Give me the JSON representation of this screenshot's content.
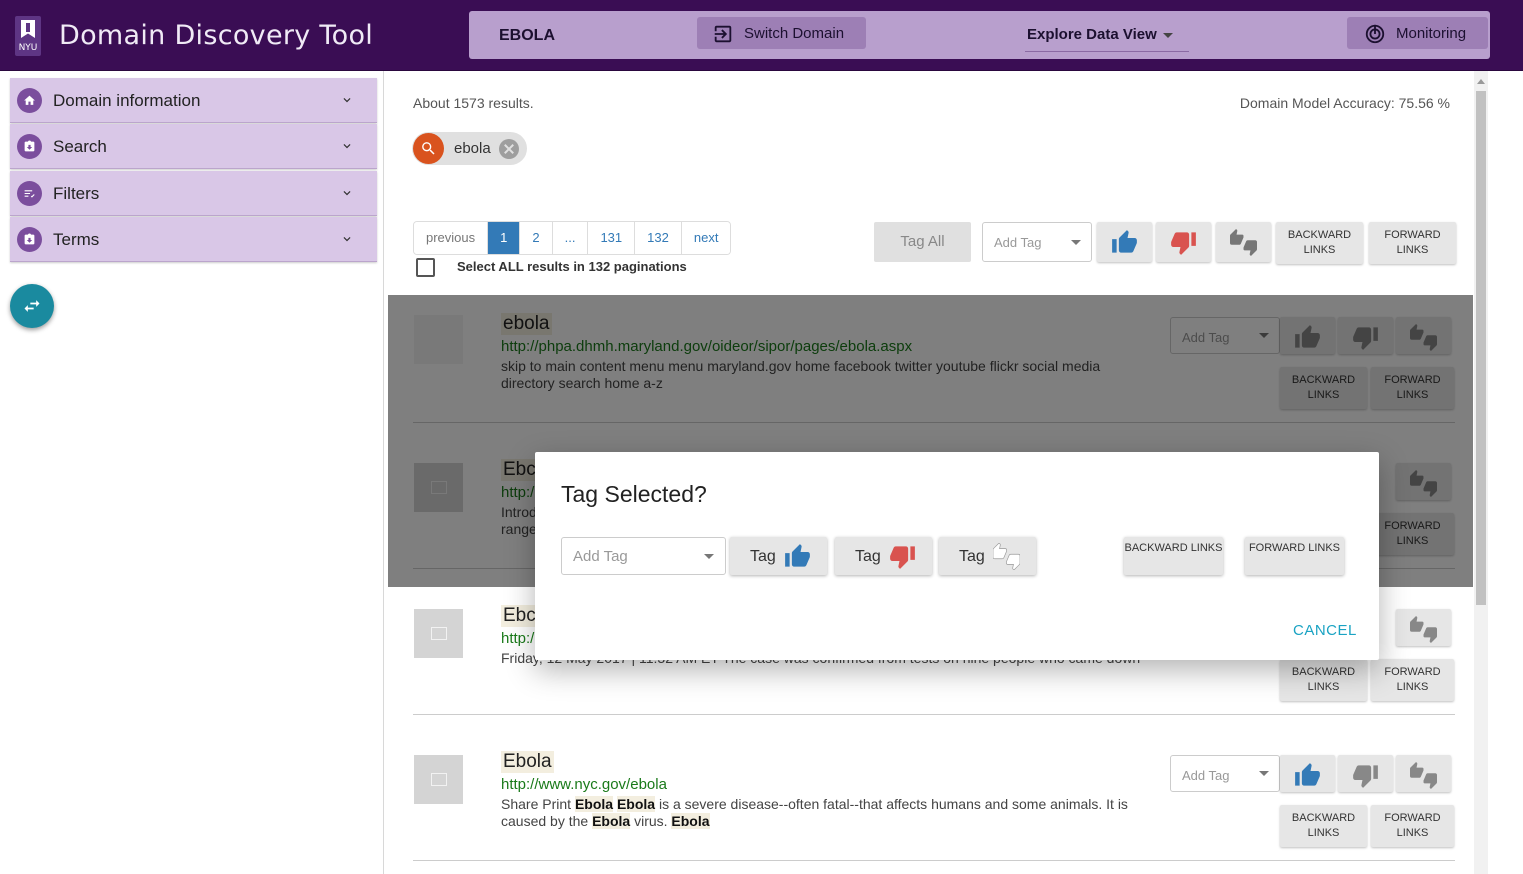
{
  "header": {
    "logo_text": "NYU",
    "app_title": "Domain Discovery Tool",
    "domain": "EBOLA",
    "switch_domain": "Switch Domain",
    "view_select": "Explore Data View",
    "monitoring": "Monitoring"
  },
  "sidebar": {
    "items": [
      {
        "label": "Domain information",
        "icon": "home-icon"
      },
      {
        "label": "Search",
        "icon": "clipboard-icon"
      },
      {
        "label": "Filters",
        "icon": "filter-list-icon"
      },
      {
        "label": "Terms",
        "icon": "clipboard-icon"
      }
    ]
  },
  "main": {
    "results_count": "About 1573 results.",
    "accuracy": "Domain Model Accuracy: 75.56 %",
    "chip_label": "ebola",
    "pagination": [
      "previous",
      "1",
      "2",
      "...",
      "131",
      "132",
      "next"
    ],
    "select_all": "Select ALL results in 132 paginations",
    "tag_all": "Tag All",
    "add_tag": "Add Tag",
    "backward_links": "BACKWARD LINKS",
    "forward_links": "FORWARD LINKS"
  },
  "results": [
    {
      "title": "ebola",
      "url": "http://phpa.dhmh.maryland.gov/oideor/sipor/pages/ebola.aspx",
      "snippet": "skip to main content   menu   menu maryland.gov home facebook twitter youtube flickr social media directory search home a-z"
    },
    {
      "title": "Ebc",
      "url": "http:/",
      "snippet_line1": "Introd",
      "snippet_line2": "range"
    },
    {
      "title": "Ebc",
      "url": "http:/",
      "snippet": "Friday, 12 May 2017 | 11:32 AM ET The case was confirmed from tests on nine people who came down"
    },
    {
      "title": "Ebola",
      "url": "http://www.nyc.gov/ebola",
      "snippet_parts": [
        "Share Print ",
        "Ebola",
        " ",
        "Ebola",
        " is a severe disease--often fatal--that affects humans and some animals. It is caused by the ",
        "Ebola",
        " virus. ",
        "Ebola"
      ]
    }
  ],
  "dialog": {
    "title": "Tag Selected?",
    "add_tag": "Add Tag",
    "tag_label": "Tag",
    "backward_links": "BACKWARD LINKS",
    "forward_links": "FORWARD LINKS",
    "cancel": "CANCEL"
  },
  "colors": {
    "header_bg": "#3a0d54",
    "top_bar": "#b89fcd",
    "accordion": "#d9c7e7",
    "accent_teal": "#1a8a9f",
    "thumb_up_blue": "#337ab7",
    "thumb_down_red": "#d9534f"
  }
}
